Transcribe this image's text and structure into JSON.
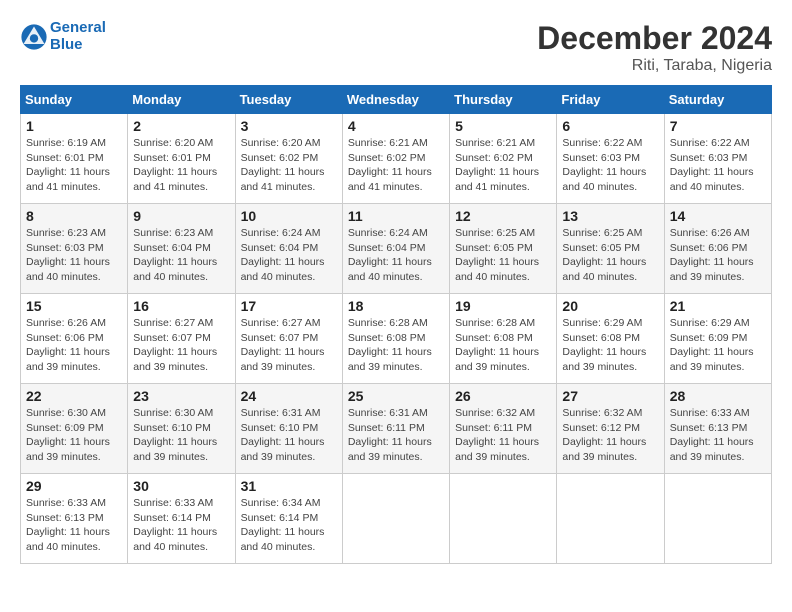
{
  "logo": {
    "text_general": "General",
    "text_blue": "Blue"
  },
  "header": {
    "month": "December 2024",
    "location": "Riti, Taraba, Nigeria"
  },
  "days_of_week": [
    "Sunday",
    "Monday",
    "Tuesday",
    "Wednesday",
    "Thursday",
    "Friday",
    "Saturday"
  ],
  "weeks": [
    [
      {
        "day": "1",
        "sunrise": "6:19 AM",
        "sunset": "6:01 PM",
        "daylight": "11 hours and 41 minutes."
      },
      {
        "day": "2",
        "sunrise": "6:20 AM",
        "sunset": "6:01 PM",
        "daylight": "11 hours and 41 minutes."
      },
      {
        "day": "3",
        "sunrise": "6:20 AM",
        "sunset": "6:02 PM",
        "daylight": "11 hours and 41 minutes."
      },
      {
        "day": "4",
        "sunrise": "6:21 AM",
        "sunset": "6:02 PM",
        "daylight": "11 hours and 41 minutes."
      },
      {
        "day": "5",
        "sunrise": "6:21 AM",
        "sunset": "6:02 PM",
        "daylight": "11 hours and 41 minutes."
      },
      {
        "day": "6",
        "sunrise": "6:22 AM",
        "sunset": "6:03 PM",
        "daylight": "11 hours and 40 minutes."
      },
      {
        "day": "7",
        "sunrise": "6:22 AM",
        "sunset": "6:03 PM",
        "daylight": "11 hours and 40 minutes."
      }
    ],
    [
      {
        "day": "8",
        "sunrise": "6:23 AM",
        "sunset": "6:03 PM",
        "daylight": "11 hours and 40 minutes."
      },
      {
        "day": "9",
        "sunrise": "6:23 AM",
        "sunset": "6:04 PM",
        "daylight": "11 hours and 40 minutes."
      },
      {
        "day": "10",
        "sunrise": "6:24 AM",
        "sunset": "6:04 PM",
        "daylight": "11 hours and 40 minutes."
      },
      {
        "day": "11",
        "sunrise": "6:24 AM",
        "sunset": "6:04 PM",
        "daylight": "11 hours and 40 minutes."
      },
      {
        "day": "12",
        "sunrise": "6:25 AM",
        "sunset": "6:05 PM",
        "daylight": "11 hours and 40 minutes."
      },
      {
        "day": "13",
        "sunrise": "6:25 AM",
        "sunset": "6:05 PM",
        "daylight": "11 hours and 40 minutes."
      },
      {
        "day": "14",
        "sunrise": "6:26 AM",
        "sunset": "6:06 PM",
        "daylight": "11 hours and 39 minutes."
      }
    ],
    [
      {
        "day": "15",
        "sunrise": "6:26 AM",
        "sunset": "6:06 PM",
        "daylight": "11 hours and 39 minutes."
      },
      {
        "day": "16",
        "sunrise": "6:27 AM",
        "sunset": "6:07 PM",
        "daylight": "11 hours and 39 minutes."
      },
      {
        "day": "17",
        "sunrise": "6:27 AM",
        "sunset": "6:07 PM",
        "daylight": "11 hours and 39 minutes."
      },
      {
        "day": "18",
        "sunrise": "6:28 AM",
        "sunset": "6:08 PM",
        "daylight": "11 hours and 39 minutes."
      },
      {
        "day": "19",
        "sunrise": "6:28 AM",
        "sunset": "6:08 PM",
        "daylight": "11 hours and 39 minutes."
      },
      {
        "day": "20",
        "sunrise": "6:29 AM",
        "sunset": "6:08 PM",
        "daylight": "11 hours and 39 minutes."
      },
      {
        "day": "21",
        "sunrise": "6:29 AM",
        "sunset": "6:09 PM",
        "daylight": "11 hours and 39 minutes."
      }
    ],
    [
      {
        "day": "22",
        "sunrise": "6:30 AM",
        "sunset": "6:09 PM",
        "daylight": "11 hours and 39 minutes."
      },
      {
        "day": "23",
        "sunrise": "6:30 AM",
        "sunset": "6:10 PM",
        "daylight": "11 hours and 39 minutes."
      },
      {
        "day": "24",
        "sunrise": "6:31 AM",
        "sunset": "6:10 PM",
        "daylight": "11 hours and 39 minutes."
      },
      {
        "day": "25",
        "sunrise": "6:31 AM",
        "sunset": "6:11 PM",
        "daylight": "11 hours and 39 minutes."
      },
      {
        "day": "26",
        "sunrise": "6:32 AM",
        "sunset": "6:11 PM",
        "daylight": "11 hours and 39 minutes."
      },
      {
        "day": "27",
        "sunrise": "6:32 AM",
        "sunset": "6:12 PM",
        "daylight": "11 hours and 39 minutes."
      },
      {
        "day": "28",
        "sunrise": "6:33 AM",
        "sunset": "6:13 PM",
        "daylight": "11 hours and 39 minutes."
      }
    ],
    [
      {
        "day": "29",
        "sunrise": "6:33 AM",
        "sunset": "6:13 PM",
        "daylight": "11 hours and 40 minutes."
      },
      {
        "day": "30",
        "sunrise": "6:33 AM",
        "sunset": "6:14 PM",
        "daylight": "11 hours and 40 minutes."
      },
      {
        "day": "31",
        "sunrise": "6:34 AM",
        "sunset": "6:14 PM",
        "daylight": "11 hours and 40 minutes."
      },
      null,
      null,
      null,
      null
    ]
  ]
}
